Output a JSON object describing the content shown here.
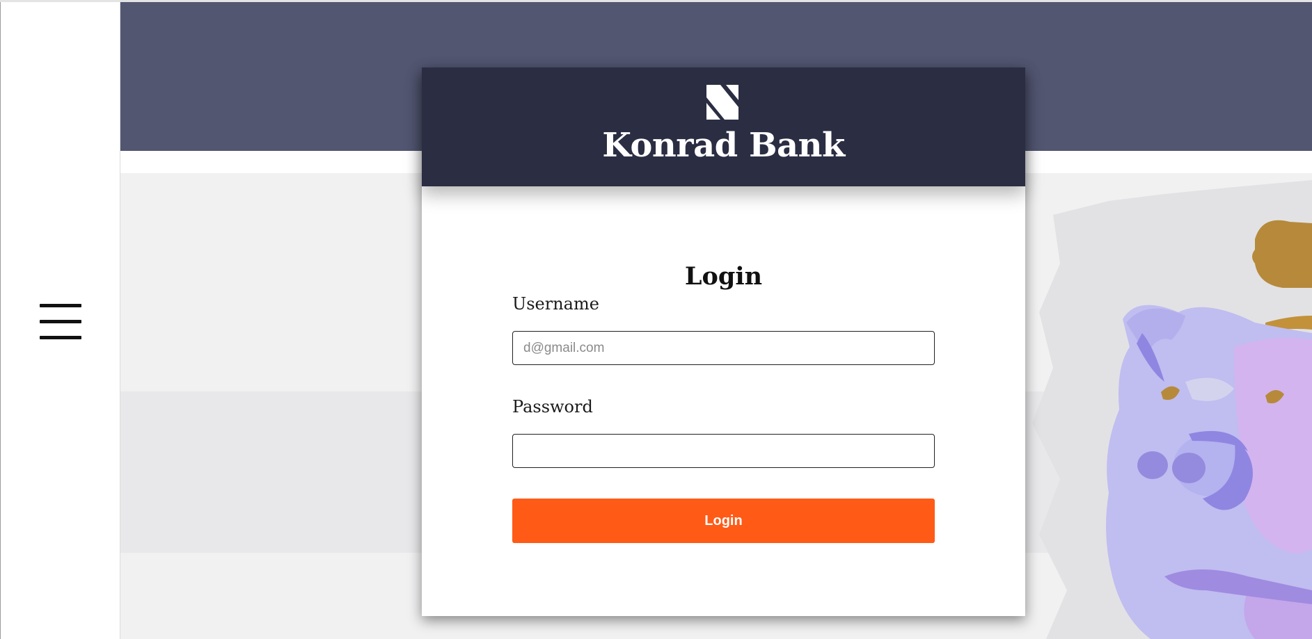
{
  "brand": {
    "name": "Konrad Bank",
    "logo_icon": "konrad-k-logo-icon",
    "header_color": "#2b2d43"
  },
  "navigation": {
    "menu_icon": "hamburger-menu-icon"
  },
  "hero": {
    "banner_color": "#525671",
    "illustration": "piggy-bank-with-coin"
  },
  "login_form": {
    "title": "Login",
    "username": {
      "label": "Username",
      "placeholder": "d@gmail.com",
      "value": ""
    },
    "password": {
      "label": "Password",
      "placeholder": "",
      "value": ""
    },
    "submit_label": "Login",
    "submit_color": "#ff5a16"
  }
}
